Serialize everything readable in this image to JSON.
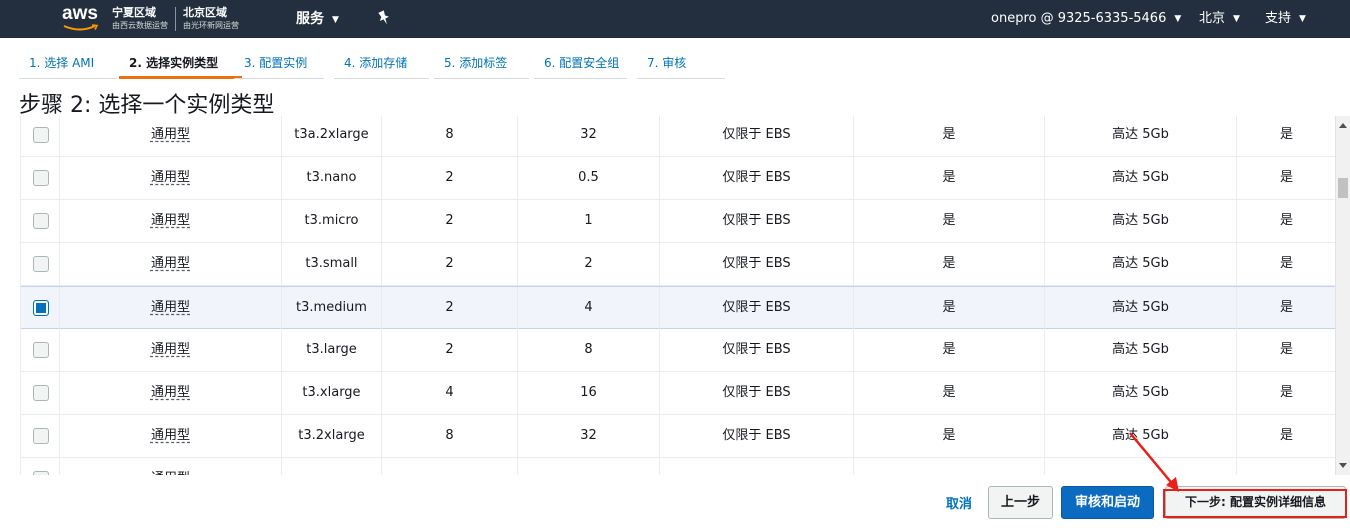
{
  "topnav": {
    "logo_text": "aws",
    "region1_title": "宁夏区域",
    "region1_sub": "由西云数据运营",
    "region2_title": "北京区域",
    "region2_sub": "由光环新网运营",
    "services_label": "服务",
    "account_label": "onepro @ 9325-6335-5466",
    "region_label": "北京",
    "support_label": "支持"
  },
  "steps": [
    {
      "label": "1. 选择 AMI"
    },
    {
      "label": "2. 选择实例类型"
    },
    {
      "label": "3. 配置实例"
    },
    {
      "label": "4. 添加存储"
    },
    {
      "label": "5. 添加标签"
    },
    {
      "label": "6. 配置安全组"
    },
    {
      "label": "7. 审核"
    }
  ],
  "page_title": "步骤 2: 选择一个实例类型",
  "table": {
    "rows": [
      {
        "family": "通用型",
        "type": "t3a.2xlarge",
        "vcpus": "8",
        "memory": "32",
        "storage": "仅限于 EBS",
        "ebs_optimized": "是",
        "network": "高达 5Gb",
        "ipv6": "是",
        "selected": false
      },
      {
        "family": "通用型",
        "type": "t3.nano",
        "vcpus": "2",
        "memory": "0.5",
        "storage": "仅限于 EBS",
        "ebs_optimized": "是",
        "network": "高达 5Gb",
        "ipv6": "是",
        "selected": false
      },
      {
        "family": "通用型",
        "type": "t3.micro",
        "vcpus": "2",
        "memory": "1",
        "storage": "仅限于 EBS",
        "ebs_optimized": "是",
        "network": "高达 5Gb",
        "ipv6": "是",
        "selected": false
      },
      {
        "family": "通用型",
        "type": "t3.small",
        "vcpus": "2",
        "memory": "2",
        "storage": "仅限于 EBS",
        "ebs_optimized": "是",
        "network": "高达 5Gb",
        "ipv6": "是",
        "selected": false
      },
      {
        "family": "通用型",
        "type": "t3.medium",
        "vcpus": "2",
        "memory": "4",
        "storage": "仅限于 EBS",
        "ebs_optimized": "是",
        "network": "高达 5Gb",
        "ipv6": "是",
        "selected": true
      },
      {
        "family": "通用型",
        "type": "t3.large",
        "vcpus": "2",
        "memory": "8",
        "storage": "仅限于 EBS",
        "ebs_optimized": "是",
        "network": "高达 5Gb",
        "ipv6": "是",
        "selected": false
      },
      {
        "family": "通用型",
        "type": "t3.xlarge",
        "vcpus": "4",
        "memory": "16",
        "storage": "仅限于 EBS",
        "ebs_optimized": "是",
        "network": "高达 5Gb",
        "ipv6": "是",
        "selected": false
      },
      {
        "family": "通用型",
        "type": "t3.2xlarge",
        "vcpus": "8",
        "memory": "32",
        "storage": "仅限于 EBS",
        "ebs_optimized": "是",
        "network": "高达 5Gb",
        "ipv6": "是",
        "selected": false
      },
      {
        "family": "通用型",
        "type": "",
        "vcpus": "",
        "memory": "",
        "storage": "",
        "ebs_optimized": "",
        "network": "",
        "ipv6": "",
        "selected": false
      }
    ]
  },
  "footer": {
    "cancel_label": "取消",
    "previous_label": "上一步",
    "review_launch_label": "审核和启动",
    "next_label": "下一步: 配置实例详细信息"
  },
  "colors": {
    "nav_bg": "#232f3e",
    "accent_orange": "#ec7211",
    "link_blue": "#0073bb",
    "primary_button": "#0a6bc1",
    "annotation_red": "#e8201a"
  }
}
